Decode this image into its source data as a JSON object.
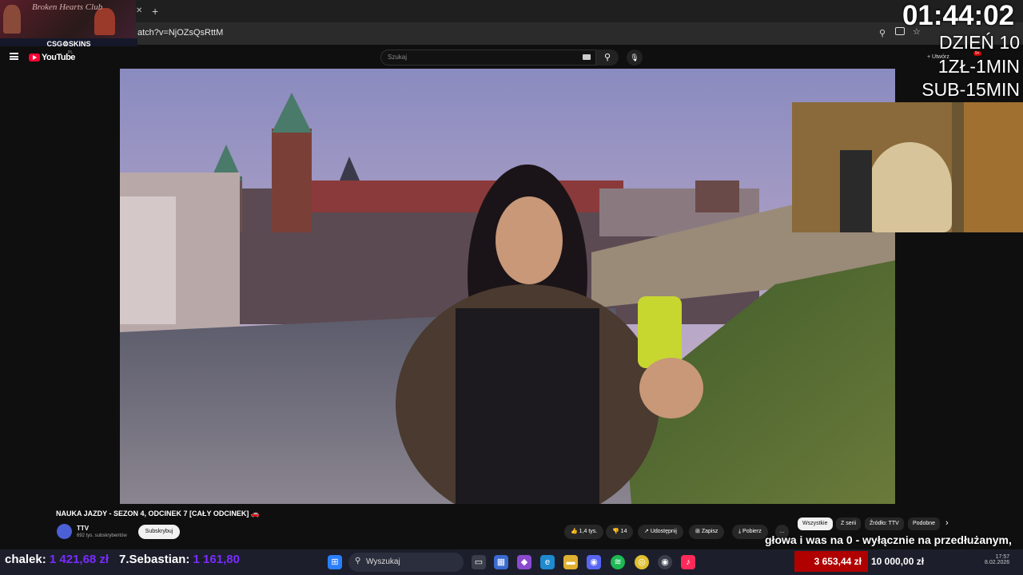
{
  "browser": {
    "url": "atch?v=NjOZsQsRttM",
    "new_tab": "+"
  },
  "stream_overlay": {
    "title": "Broken Hearts Club",
    "sponsor": "CSG⚙SKINS",
    "timer": "01:44:02",
    "day": "DZIEŃ 10",
    "rate1": "1ZŁ-1MIN",
    "rate2": "SUB-15MIN"
  },
  "youtube": {
    "logo": "YouTube",
    "logo_region": "PL",
    "search_placeholder": "Szukaj",
    "create_label": "Utwórz",
    "notif_badge": "9+",
    "video_title": "NAUKA JAZDY - SEZON 4, ODCINEK 7 [CAŁY ODCINEK] 🚗",
    "channel_name": "TTV",
    "channel_subs": "692 tys. subskrybentów",
    "subscribe_label": "Subskrybuj",
    "likes": "1,4 tys.",
    "dislikes": "14",
    "share_label": "Udostępnij",
    "save_label": "Zapisz",
    "download_label": "Pobierz",
    "more_label": "…",
    "chips": [
      "Wszystkie",
      "Z serii",
      "Źródło: TTV",
      "Podobne"
    ]
  },
  "stream_ticker": {
    "entry1_name": "chalek:",
    "entry1_value": "1 421,68 zł",
    "entry2_name": "7.Sebastian:",
    "entry2_value": "1 161,80"
  },
  "chat_overlay": {
    "line": "głowa i was na 0 - wyłącznie na przedłużanym,"
  },
  "donations": {
    "current": "3 653,44 zł",
    "goal": "10 000,00 zł"
  },
  "taskbar": {
    "search_label": "Wyszukaj",
    "time": "17:57",
    "date": "8.02.2026"
  },
  "colors": {
    "accent_red": "#ff0033",
    "ticker_purple": "#7a2bff",
    "donation_red": "#b00000"
  }
}
